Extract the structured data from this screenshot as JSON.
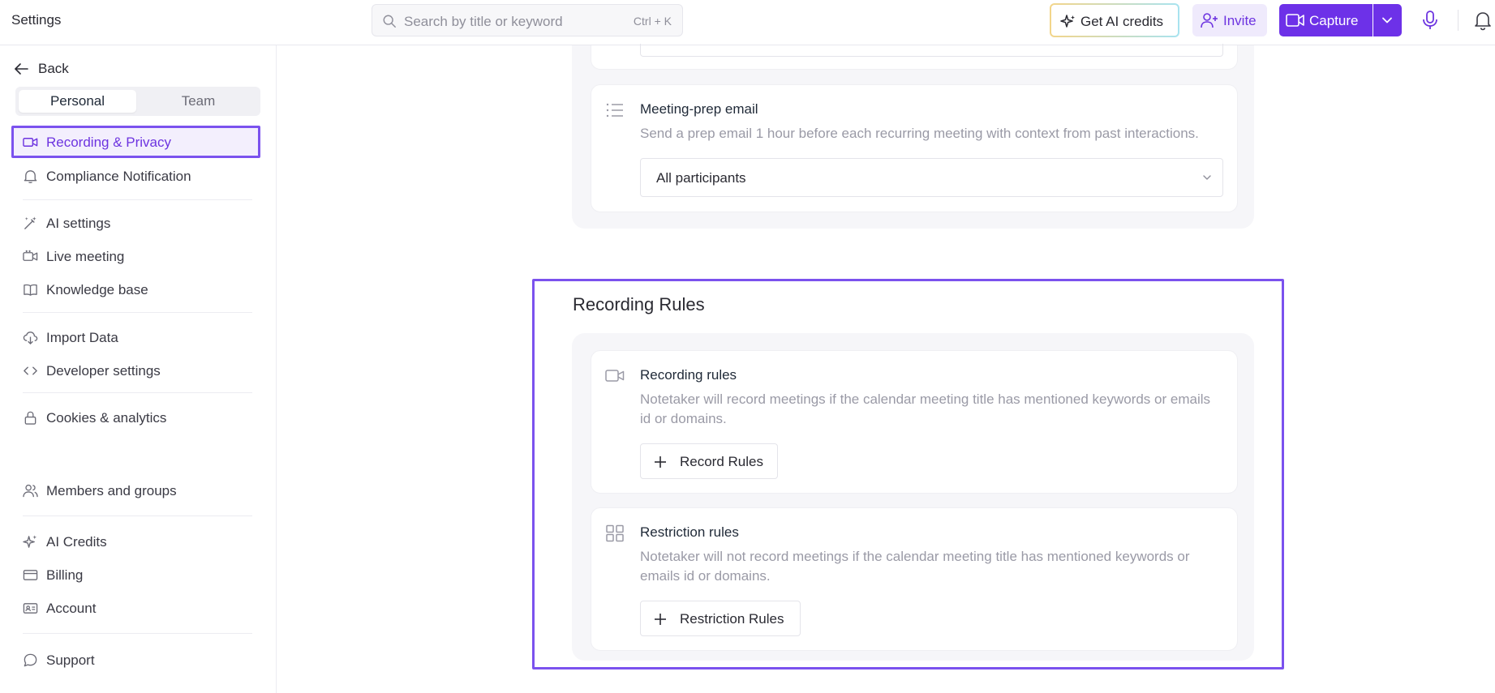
{
  "app": {
    "title": "Settings"
  },
  "search": {
    "placeholder": "Search by title or keyword",
    "shortcut": "Ctrl + K",
    "icon": "search-icon"
  },
  "header": {
    "credits_label": "Get AI credits",
    "invite_label": "Invite",
    "capture_label": "Capture",
    "accent_color": "#6d31e8"
  },
  "sidebar": {
    "back_label": "Back",
    "tabs": [
      {
        "label": "Personal",
        "active": true
      },
      {
        "label": "Team",
        "active": false
      }
    ],
    "items": [
      {
        "label": "Recording & Privacy",
        "icon": "video-camera-icon",
        "active": true
      },
      {
        "label": "Compliance Notification",
        "icon": "bell-icon"
      },
      {
        "label": "AI settings",
        "icon": "magic-wand-icon"
      },
      {
        "label": "Live meeting",
        "icon": "video-call-icon"
      },
      {
        "label": "Knowledge base",
        "icon": "book-icon"
      },
      {
        "label": "Import Data",
        "icon": "cloud-download-icon"
      },
      {
        "label": "Developer settings",
        "icon": "code-icon"
      },
      {
        "label": "Cookies & analytics",
        "icon": "lock-icon"
      },
      {
        "label": "Members and groups",
        "icon": "users-icon"
      },
      {
        "label": "AI Credits",
        "icon": "sparkle-icon"
      },
      {
        "label": "Billing",
        "icon": "credit-card-icon"
      },
      {
        "label": "Account",
        "icon": "id-card-icon"
      },
      {
        "label": "Support",
        "icon": "chat-bubble-icon"
      }
    ]
  },
  "main": {
    "meeting_prep": {
      "title": "Meeting-prep email",
      "description": "Send a prep email 1 hour before each recurring meeting with context from past interactions.",
      "select_value": "All participants",
      "icon": "list-icon"
    },
    "recording_rules_section": {
      "heading": "Recording Rules",
      "recording_rules": {
        "title": "Recording rules",
        "description": "Notetaker will record meetings if the calendar meeting title has mentioned keywords or emails id or domains.",
        "button_label": "Record Rules",
        "icon": "video-camera-icon"
      },
      "restriction_rules": {
        "title": "Restriction rules",
        "description": "Notetaker will not record meetings if the calendar meeting title has mentioned keywords or emails id or domains.",
        "button_label": "Restriction Rules",
        "icon": "grid-icon"
      }
    }
  }
}
